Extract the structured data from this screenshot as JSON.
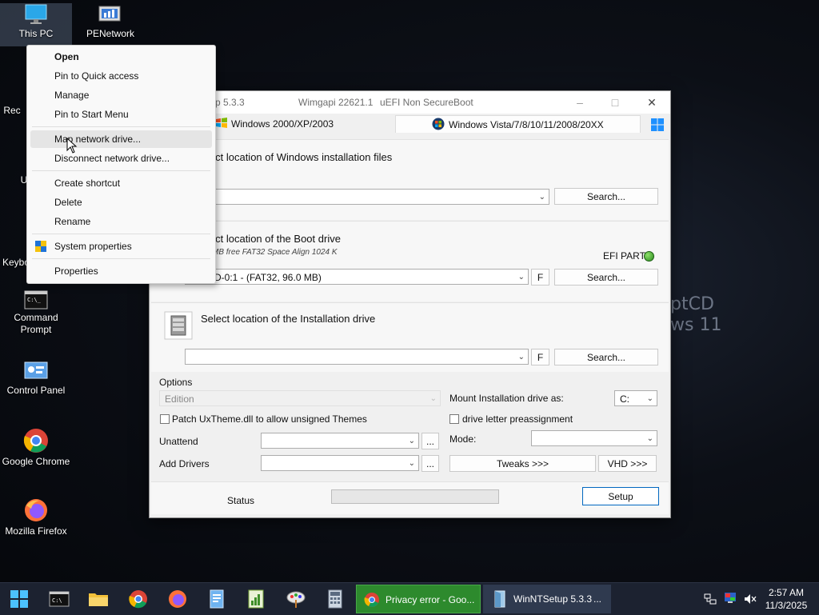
{
  "desktop": {
    "wallpaper_text": [
      "ptCD",
      "ws 11"
    ],
    "icons": [
      {
        "label": "This PC",
        "icon": "computer-icon"
      },
      {
        "label": "PENetwork",
        "icon": "network-icon"
      },
      {
        "label": "Rec",
        "icon": "recycle-bin-icon"
      },
      {
        "label": "U",
        "icon": "user-icon"
      },
      {
        "label": "Keybo",
        "icon": "keyboard-icon"
      },
      {
        "label": "Command Prompt",
        "icon": "cmd-icon"
      },
      {
        "label": "Control Panel",
        "icon": "control-panel-icon"
      },
      {
        "label": "Google Chrome",
        "icon": "chrome-icon"
      },
      {
        "label": "Mozilla Firefox",
        "icon": "firefox-icon"
      }
    ]
  },
  "context_menu": {
    "items": [
      {
        "label": "Open"
      },
      {
        "label": "Pin to Quick access"
      },
      {
        "label": "Manage"
      },
      {
        "label": "Pin to Start Menu"
      },
      {
        "label": "Map network drive..."
      },
      {
        "label": "Disconnect network drive..."
      },
      {
        "label": "Create shortcut"
      },
      {
        "label": "Delete"
      },
      {
        "label": "Rename"
      },
      {
        "label": "System properties"
      },
      {
        "label": "Properties"
      }
    ]
  },
  "window": {
    "title_app": "tup 5.3.3",
    "title_wimgapi": "Wimgapi 22621.1",
    "title_boot": "uEFI Non SecureBoot",
    "tabs": {
      "legacy": "Windows 2000/XP/2003",
      "modern": "Windows Vista/7/8/10/11/2008/20XX"
    },
    "section_install_files": {
      "label": "lect location of Windows installation files",
      "value": "",
      "search": "Search..."
    },
    "section_boot": {
      "label": "lect location of the Boot drive",
      "info": "MB free FAT32 Space Align 1024 K",
      "efi_label": "EFI PART",
      "value": "D-0:1 -   (FAT32, 96.0 MB)",
      "f": "F",
      "search": "Search..."
    },
    "section_install_drive": {
      "label": "Select location of the Installation drive",
      "value": "",
      "f": "F",
      "search": "Search..."
    },
    "options": {
      "title": "Options",
      "edition_placeholder": "Edition",
      "mount_label": "Mount Installation drive as:",
      "mount_value": "C:",
      "patch_label": "Patch UxTheme.dll to allow unsigned Themes",
      "preassign_label": "drive letter preassignment",
      "unattend_label": "Unattend",
      "mode_label": "Mode:",
      "add_drivers_label": "Add Drivers",
      "ellipsis": "...",
      "tweaks": "Tweaks >>>",
      "vhd": "VHD >>>"
    },
    "status_label": "Status",
    "setup_button": "Setup"
  },
  "taskbar": {
    "apps": [
      {
        "label": "Privacy error - Goo...",
        "icon": "chrome-icon"
      },
      {
        "label": "WinNTSetup 5.3.3",
        "icon": "setup-icon",
        "more": "..."
      }
    ],
    "time": "2:57 AM",
    "date": "11/3/2025"
  }
}
